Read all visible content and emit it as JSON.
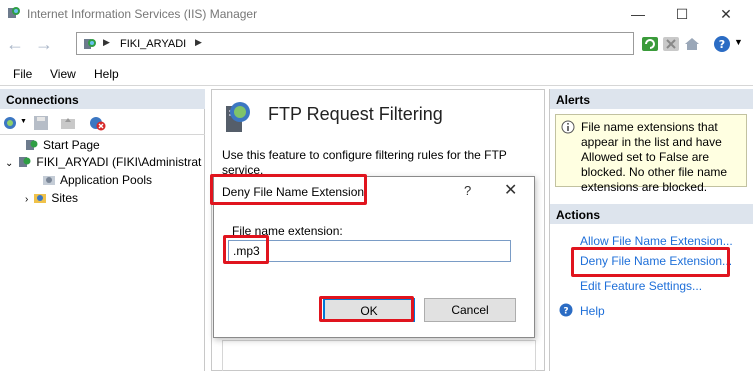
{
  "window": {
    "title": "Internet Information Services (IIS) Manager"
  },
  "address": {
    "segment": "FIKI_ARYADI"
  },
  "menu": [
    "File",
    "View",
    "Help"
  ],
  "connections": {
    "header": "Connections",
    "tree": [
      {
        "label": "Start Page"
      },
      {
        "label": "FIKI_ARYADI (FIKI\\Administrat"
      },
      {
        "label": "Application Pools"
      },
      {
        "label": "Sites"
      }
    ]
  },
  "feature": {
    "title": "FTP Request Filtering",
    "description": "Use this feature to configure filtering rules for the FTP service."
  },
  "dialog": {
    "title": "Deny File Name Extension",
    "help_glyph": "?",
    "close_glyph": "✕",
    "field_label": "File name extension:",
    "field_value": ".mp3",
    "ok_label": "OK",
    "cancel_label": "Cancel"
  },
  "alerts": {
    "header": "Alerts",
    "message": "File name extensions that appear in the list and have Allowed set to False are blocked. No other file name extensions are blocked."
  },
  "actions": {
    "header": "Actions",
    "items": [
      {
        "label": "Allow File Name Extension..."
      },
      {
        "label": "Deny File Name Extension..."
      },
      {
        "label": "Edit Feature Settings..."
      },
      {
        "label": "Help"
      }
    ]
  },
  "colors": {
    "highlight": "#e0141e",
    "link": "#1e6fd9",
    "alert_bg": "#ffffe1",
    "panel_header": "#dde4ed"
  },
  "icons": [
    "iis-app-icon",
    "minimize-icon",
    "maximize-icon",
    "close-icon",
    "back-icon",
    "forward-icon",
    "server-icon",
    "refresh-icon",
    "stop-icon",
    "home-icon",
    "help-icon",
    "connect-icon",
    "save-icon",
    "folder-up-icon",
    "disconnect-icon",
    "start-page-icon",
    "app-pools-icon",
    "sites-icon",
    "ftp-feature-icon",
    "info-icon"
  ]
}
